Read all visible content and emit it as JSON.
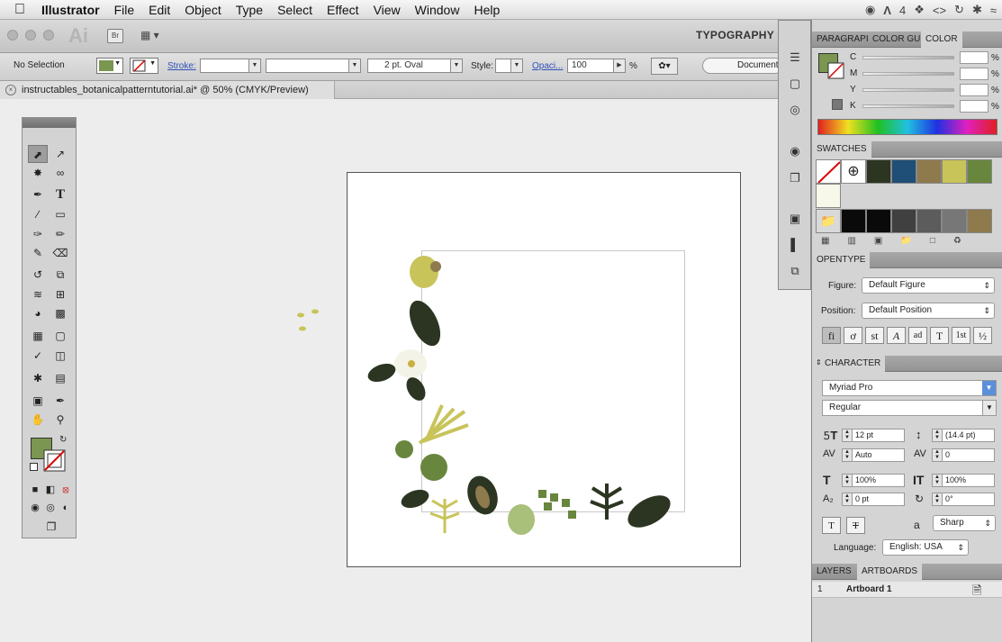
{
  "menubar": {
    "apple": "",
    "app": "Illustrator",
    "items": [
      "File",
      "Edit",
      "Object",
      "Type",
      "Select",
      "Effect",
      "View",
      "Window",
      "Help"
    ],
    "right_text": "4"
  },
  "appbar": {
    "logo": "Ai",
    "bridge": "Br",
    "workspace": "TYPOGRAPHY"
  },
  "control": {
    "selection": "No Selection",
    "stroke_label": "Stroke:",
    "brush": "2 pt. Oval",
    "style_label": "Style:",
    "opacity_label": "Opaci...",
    "opacity_value": "100",
    "percent": "%",
    "document_btn": "Document",
    "fill_color": "#7a9650"
  },
  "doc": {
    "tab_title": "instructables_botanicalpatterntutorial.ai* @ 50% (CMYK/Preview)"
  },
  "color_panel": {
    "tabs": [
      "PARAGRAPI",
      "COLOR GUI",
      "COLOR"
    ],
    "channels": [
      "C",
      "M",
      "Y",
      "K"
    ],
    "percent": "%"
  },
  "swatches": {
    "title": "SWATCHES",
    "row1": [
      "#2c3521",
      "#1f4e77",
      "#8f7a4e",
      "#c8c45a",
      "#68863d"
    ],
    "row3": [
      "#0a0a0a",
      "#0a0a0a",
      "#404040",
      "#5c5c5c",
      "#777777",
      "#8f7a4e"
    ]
  },
  "opentype": {
    "title": "OPENTYPE",
    "figure_label": "Figure:",
    "figure_value": "Default Figure",
    "position_label": "Position:",
    "position_value": "Default Position",
    "glyphs": [
      "fi",
      "ơ",
      "st",
      "A",
      "ad",
      "T",
      "1st",
      "½"
    ]
  },
  "character": {
    "title": "CHARACTER",
    "font": "Myriad Pro",
    "style": "Regular",
    "size": "12 pt",
    "leading": "(14.4 pt)",
    "kerning": "Auto",
    "tracking": "0",
    "vscale": "100%",
    "hscale": "100%",
    "baseline": "0 pt",
    "rotation": "0°",
    "aa_label": "a",
    "aa_value": "Sharp",
    "language_label": "Language:",
    "language_value": "English: USA"
  },
  "layers": {
    "tabs": [
      "LAYERS",
      "ARTBOARDS"
    ],
    "row_num": "1",
    "row_name": "Artboard 1"
  }
}
